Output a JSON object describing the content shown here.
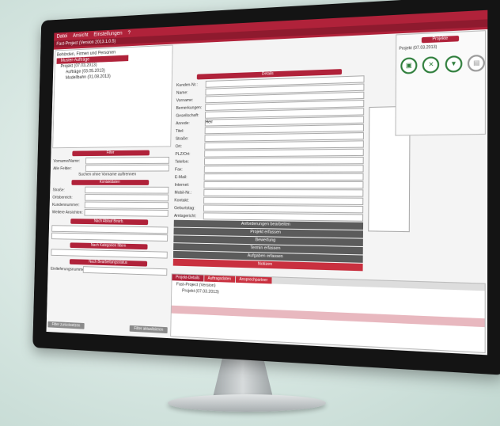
{
  "menu": [
    "Datei",
    "Ansicht",
    "Einstellungen",
    "?"
  ],
  "tab_label": "Fast-Project (Version 2013.1.0.5)",
  "tree": [
    {
      "label": "Behörden, Firmen und Personen",
      "level": 0,
      "selected": false
    },
    {
      "label": "Muster-Aufträge",
      "level": 1,
      "selected": true
    },
    {
      "label": "Projekt (07.03.2013)",
      "level": 1,
      "selected": false
    },
    {
      "label": "Aufträge (03.05.2013)",
      "level": 2,
      "selected": false
    },
    {
      "label": "Modellbahn (01.08.2013)",
      "level": 2,
      "selected": false
    }
  ],
  "filter": {
    "title": "Filter",
    "labels": [
      "Vorname/Name:",
      "Alle Felder:"
    ],
    "checkbox": "Suchen ohne Vorname auftrennen",
    "sub_title": "Kontaktdaten",
    "fields": [
      "Straße:",
      "Ortsbereich:",
      "Kundennummer:",
      "Weitere Ansichten:"
    ],
    "timer_title": "Nach Ablauf Bearb.",
    "timer_title2": "Nach Kategorien filtern",
    "status_title": "Nach Bearbeitungsstatus",
    "rows": [
      "Einlieferungsnummer:"
    ]
  },
  "buttons": {
    "reset": "Filter zurücksetzen",
    "apply": "Filter aktualisieren"
  },
  "form": {
    "fields": [
      "Kunden-Nr.:",
      "Name:",
      "Vorname:",
      "Bemerkungen:",
      "Gesellschaft:",
      "Anrede:",
      "Titel:",
      "Straße:",
      "Ort:",
      "PLZ/Ort:",
      "Telefon:",
      "Fax:",
      "E-Mail:",
      "Internet:",
      "Mobil-Nr.:",
      "Kontakt:",
      "Geburtstag:",
      "Amtsgericht:",
      "Kategorie:"
    ],
    "values": [
      "",
      "",
      "",
      "",
      "",
      "Herr",
      "",
      "",
      "",
      "",
      "",
      "",
      "",
      "",
      "",
      "",
      "",
      "",
      ""
    ],
    "section": "Details"
  },
  "actions": [
    "Anforderungen bearbeiten",
    "Projekt erfassen",
    "Bewertung",
    "Termin erfassen",
    "Aufgaben erfassen",
    "Notizen"
  ],
  "project_panel": {
    "title": "Projekte",
    "label": "Projekt (07.03.2013)"
  },
  "lower_tabs": [
    "Projekt-Details",
    "Auftragsdaten",
    "Ansprechpartner"
  ],
  "lower_tree": [
    "Fast-Project (Version)",
    "Projekt (07.03.2013)"
  ]
}
